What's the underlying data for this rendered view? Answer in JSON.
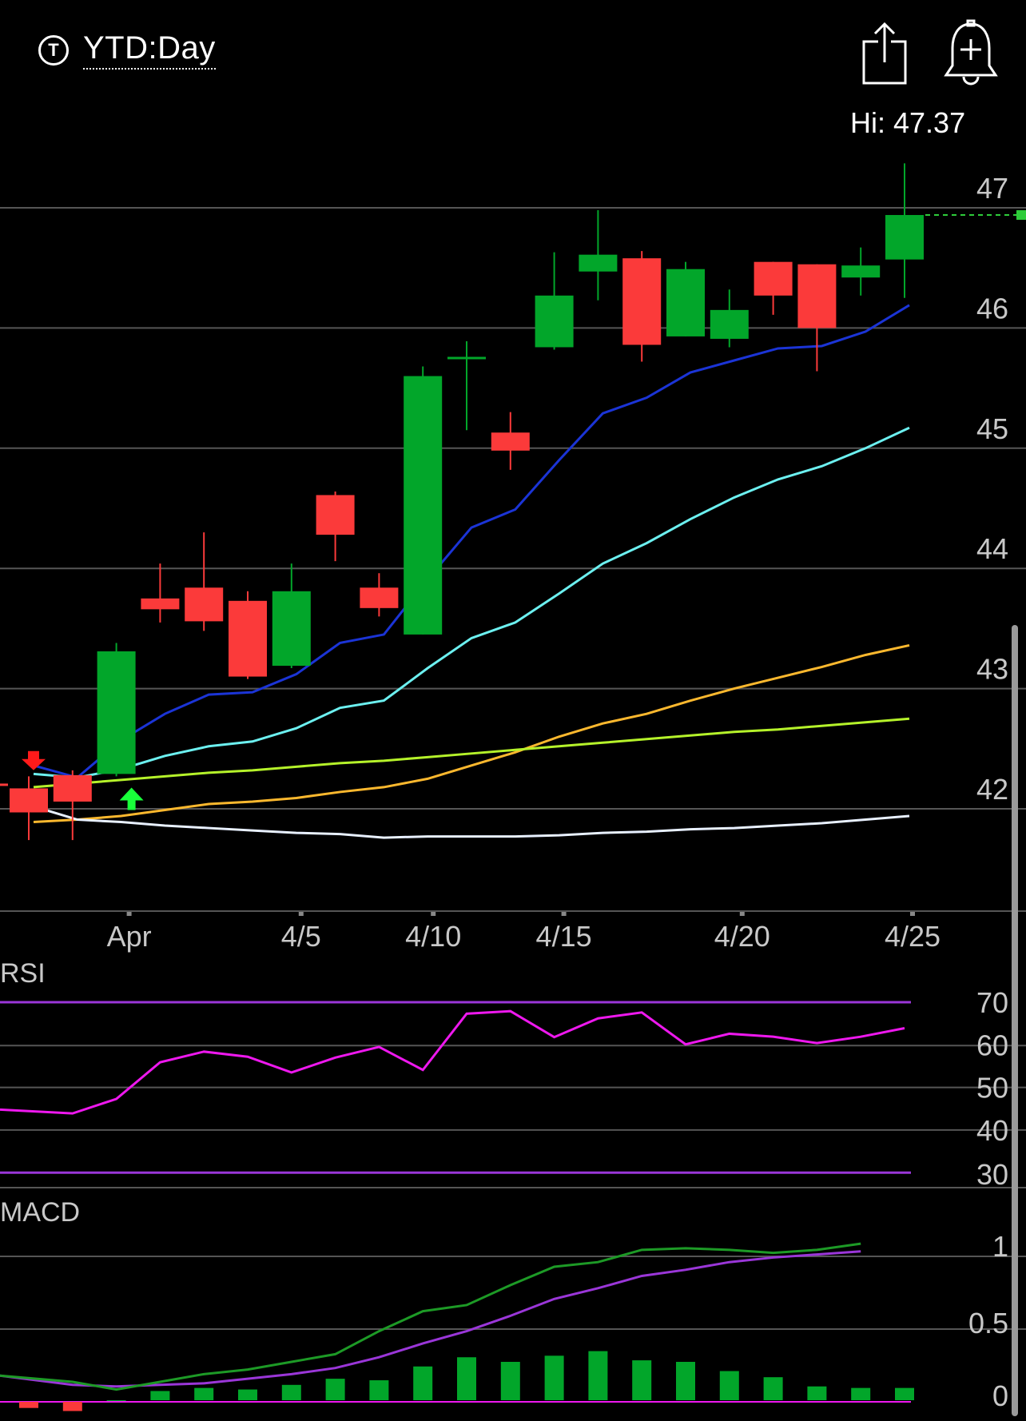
{
  "header": {
    "period_icon_letter": "T",
    "period_label": "YTD:Day",
    "hi_label": "Hi: 47.37",
    "share_icon": "share-icon",
    "alert_icon": "bell-plus-icon"
  },
  "colors": {
    "up": "#02a62a",
    "down": "#fb3a3a",
    "ema_fast": "#1b34d6",
    "ema_mid": "#6cf0f0",
    "ema_slow": "#fcb82e",
    "sma": "#b5f22a",
    "sma_long": "#e8f0ff",
    "rsi": "#ee18ee",
    "rsi_bands": "#9a36d8",
    "macd": "#1d9a26",
    "signal": "#9a36d8",
    "hist_up": "#02a62a",
    "hist_down": "#fb3a3a",
    "grid": "#555555"
  },
  "chart_data": [
    {
      "type": "candlestick",
      "title": "",
      "ylim": [
        41.2,
        47.55
      ],
      "y_ticks": [
        42,
        43,
        44,
        45,
        46,
        47
      ],
      "x_tick_labels": [
        {
          "label": "Apr",
          "index": 2
        },
        {
          "label": "4/5",
          "index": 6
        },
        {
          "label": "4/10",
          "index": 9
        },
        {
          "label": "4/15",
          "index": 12
        },
        {
          "label": "4/20",
          "index": 16
        },
        {
          "label": "4/25",
          "index": 20
        }
      ],
      "candles": [
        {
          "open": 42.17,
          "high": 42.27,
          "low": 41.74,
          "close": 41.97
        },
        {
          "open": 42.28,
          "high": 42.32,
          "low": 41.74,
          "close": 42.06
        },
        {
          "open": 42.29,
          "high": 43.38,
          "low": 42.27,
          "close": 43.31
        },
        {
          "open": 43.75,
          "high": 44.04,
          "low": 43.55,
          "close": 43.66
        },
        {
          "open": 43.84,
          "high": 44.3,
          "low": 43.48,
          "close": 43.56
        },
        {
          "open": 43.73,
          "high": 43.81,
          "low": 43.08,
          "close": 43.1
        },
        {
          "open": 43.19,
          "high": 44.04,
          "low": 43.17,
          "close": 43.81
        },
        {
          "open": 44.61,
          "high": 44.64,
          "low": 44.06,
          "close": 44.28
        },
        {
          "open": 43.84,
          "high": 43.96,
          "low": 43.6,
          "close": 43.67
        },
        {
          "open": 43.45,
          "high": 45.68,
          "low": 43.45,
          "close": 45.6
        },
        {
          "open": 45.76,
          "high": 45.89,
          "low": 45.15,
          "close": 45.76
        },
        {
          "open": 45.13,
          "high": 45.3,
          "low": 44.82,
          "close": 44.98
        },
        {
          "open": 45.84,
          "high": 46.63,
          "low": 45.82,
          "close": 46.27
        },
        {
          "open": 46.47,
          "high": 46.98,
          "low": 46.23,
          "close": 46.61
        },
        {
          "open": 46.58,
          "high": 46.64,
          "low": 45.72,
          "close": 45.86
        },
        {
          "open": 45.93,
          "high": 46.55,
          "low": 45.93,
          "close": 46.49
        },
        {
          "open": 45.91,
          "high": 46.32,
          "low": 45.84,
          "close": 46.15
        },
        {
          "open": 46.55,
          "high": 46.55,
          "low": 46.11,
          "close": 46.27
        },
        {
          "open": 46.53,
          "high": 46.53,
          "low": 45.64,
          "close": 46.0
        },
        {
          "open": 46.42,
          "high": 46.67,
          "low": 46.27,
          "close": 46.52
        },
        {
          "open": 46.57,
          "high": 47.37,
          "low": 46.25,
          "close": 46.94
        }
      ],
      "last_price": 46.94,
      "signals": [
        {
          "index": 0,
          "type": "sell"
        },
        {
          "index": 2,
          "type": "buy"
        }
      ],
      "overlays": [
        {
          "color_key": "ema_fast",
          "values": [
            42.36,
            42.26,
            42.57,
            42.79,
            42.95,
            42.97,
            43.12,
            43.38,
            43.45,
            43.91,
            44.34,
            44.49,
            44.9,
            45.29,
            45.42,
            45.63,
            45.73,
            45.83,
            45.85,
            45.97,
            46.19
          ]
        },
        {
          "color_key": "ema_mid",
          "values": [
            42.29,
            42.26,
            42.33,
            42.44,
            42.52,
            42.56,
            42.67,
            42.84,
            42.9,
            43.17,
            43.42,
            43.55,
            43.79,
            44.04,
            44.21,
            44.41,
            44.59,
            44.74,
            44.85,
            45.0,
            45.17
          ]
        },
        {
          "color_key": "ema_slow",
          "values": [
            41.89,
            41.91,
            41.94,
            41.99,
            42.04,
            42.06,
            42.09,
            42.14,
            42.18,
            42.25,
            42.36,
            42.47,
            42.6,
            42.71,
            42.79,
            42.9,
            43.0,
            43.09,
            43.18,
            43.28,
            43.36
          ]
        },
        {
          "color_key": "sma",
          "values": [
            42.18,
            42.21,
            42.24,
            42.27,
            42.3,
            42.32,
            42.35,
            42.38,
            42.4,
            42.43,
            42.46,
            42.49,
            42.52,
            42.55,
            42.58,
            42.61,
            42.64,
            42.66,
            42.69,
            42.72,
            42.75
          ]
        },
        {
          "color_key": "sma_long",
          "values": [
            42.02,
            41.91,
            41.89,
            41.86,
            41.84,
            41.82,
            41.8,
            41.79,
            41.76,
            41.77,
            41.77,
            41.77,
            41.78,
            41.8,
            41.81,
            41.83,
            41.84,
            41.86,
            41.88,
            41.91,
            41.94
          ]
        }
      ]
    },
    {
      "type": "line",
      "title": "RSI",
      "ylim": [
        30,
        70
      ],
      "y_ticks": [
        70,
        60,
        50,
        40,
        30
      ],
      "bands": [
        70,
        30
      ],
      "values": [
        43.9,
        47.3,
        55.9,
        58.4,
        57.2,
        53.5,
        57.0,
        59.5,
        54.1,
        67.3,
        67.9,
        61.8,
        66.2,
        67.6,
        60.1,
        62.6,
        61.9,
        60.4,
        61.9,
        63.9
      ]
    },
    {
      "type": "bar+line",
      "title": "MACD",
      "ylim": [
        0,
        1
      ],
      "y_ticks": [
        1,
        0.5,
        0
      ],
      "macd": [
        0.12,
        0.07,
        0.12,
        0.17,
        0.2,
        0.25,
        0.3,
        0.45,
        0.58,
        0.62,
        0.75,
        0.87,
        0.9,
        0.98,
        0.99,
        0.98,
        0.96,
        0.98,
        1.02
      ],
      "signal": [
        0.1,
        0.09,
        0.1,
        0.11,
        0.14,
        0.17,
        0.21,
        0.28,
        0.37,
        0.45,
        0.55,
        0.66,
        0.73,
        0.81,
        0.85,
        0.9,
        0.93,
        0.95,
        0.97
      ],
      "histogram": [
        -0.04,
        -0.06,
        0.0,
        0.06,
        0.08,
        0.07,
        0.1,
        0.14,
        0.13,
        0.22,
        0.28,
        0.25,
        0.29,
        0.32,
        0.26,
        0.25,
        0.19,
        0.15,
        0.09,
        0.08,
        0.08
      ]
    }
  ]
}
